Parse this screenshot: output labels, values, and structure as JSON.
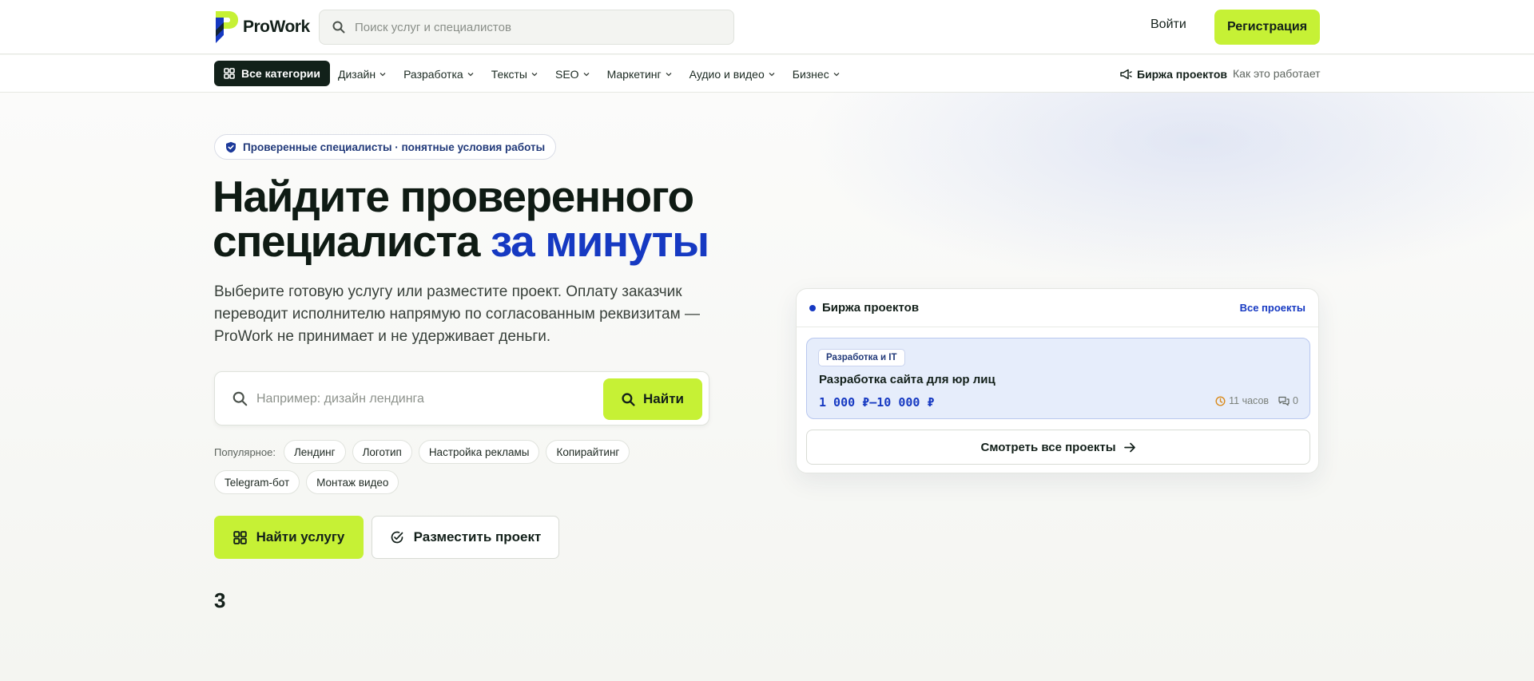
{
  "header": {
    "logo_text": "ProWork",
    "search_placeholder": "Поиск услуг и специалистов",
    "login_label": "Войти",
    "register_label": "Регистрация"
  },
  "nav": {
    "all_categories_label": "Все категории",
    "categories": [
      "Дизайн",
      "Разработка",
      "Тексты",
      "SEO",
      "Маркетинг",
      "Аудио и видео",
      "Бизнес"
    ],
    "exchange_label": "Биржа проектов",
    "how_label": "Как это работает"
  },
  "hero": {
    "badge_text": "Проверенные специалисты · понятные условия работы",
    "title_line1": "Найдите проверенного",
    "title_line2_main": "специалиста ",
    "title_line2_accent": "за минуты",
    "subtitle": "Выберите готовую услугу или разместите проект. Оплату заказчик переводит исполнителю напрямую по согласованным реквизитам — ProWork не принимает и не удерживает деньги.",
    "search_placeholder": "Например: дизайн лендинга",
    "search_button": "Найти",
    "popular_label": "Популярное:",
    "popular_chips": [
      "Лендинг",
      "Логотип",
      "Настройка рекламы",
      "Копирайтинг",
      "Telegram-бот",
      "Монтаж видео"
    ],
    "cta_primary": "Найти услугу",
    "cta_secondary": "Разместить проект",
    "stat_number": "3"
  },
  "projects_card": {
    "title": "Биржа проектов",
    "all_link": "Все проекты",
    "item": {
      "category": "Разработка и IT",
      "name": "Разработка сайта для юр лиц",
      "price": "1 000 ₽–10 000 ₽",
      "time": "11 часов",
      "responses": "0"
    },
    "view_all_button": "Смотреть все проекты"
  },
  "colors": {
    "accent_lime": "#c6f135",
    "brand_blue": "#1639c2",
    "dark": "#12211a"
  }
}
